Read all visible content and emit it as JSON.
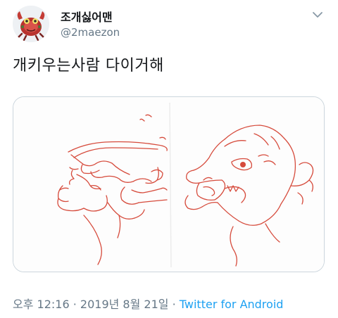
{
  "user": {
    "display_name": "조개싫어맨",
    "handle": "@2maezon",
    "avatar_icon": "crab-mascot-avatar-icon"
  },
  "menu_icon": "chevron-down-icon",
  "tweet": {
    "text": "개키우는사람 다이거해"
  },
  "media": {
    "kind": "sketch-drawing",
    "stroke_color": "#d64b3c",
    "panels": [
      "hand-pressing-dog-head",
      "dog-face-snarling"
    ]
  },
  "meta": {
    "time": "오후 12:16",
    "separator_1": " · ",
    "date": "2019년 8월 21일",
    "separator_2": " · ",
    "source": "Twitter for Android"
  },
  "colors": {
    "text": "#14171a",
    "secondary": "#657786",
    "link": "#1da1f2",
    "border": "#ccd6dd"
  }
}
